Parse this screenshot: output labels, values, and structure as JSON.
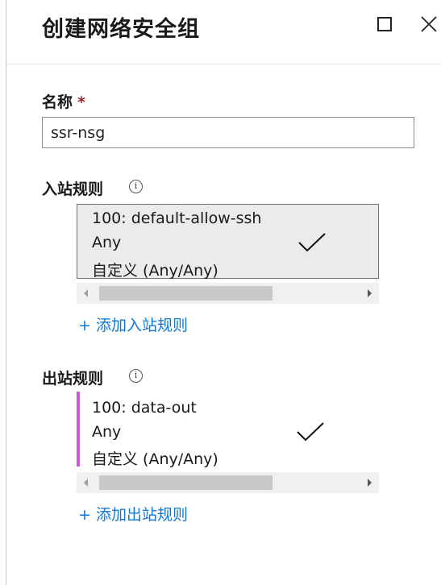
{
  "panel": {
    "title": "创建网络安全组"
  },
  "name_field": {
    "label": "名称",
    "required_mark": "*",
    "value": "ssr-nsg"
  },
  "inbound": {
    "label": "入站规则",
    "info_icon": "i",
    "rule": {
      "name": "100: default-allow-ssh",
      "source": "Any",
      "service": "自定义 (Any/Any)",
      "status_icon": "checkmark-icon"
    },
    "add_link": "+ 添加入站规则"
  },
  "outbound": {
    "label": "出站规则",
    "info_icon": "i",
    "rule": {
      "name": "100: data-out",
      "source": "Any",
      "service": "自定义 (Any/Any)",
      "status_icon": "checkmark-icon"
    },
    "add_link": "+ 添加出站规则"
  },
  "colors": {
    "accent_link": "#0f78d4",
    "required": "#a4262c",
    "outbound_highlight": "#c55cd0",
    "selected_row_bg": "#ebebeb"
  }
}
